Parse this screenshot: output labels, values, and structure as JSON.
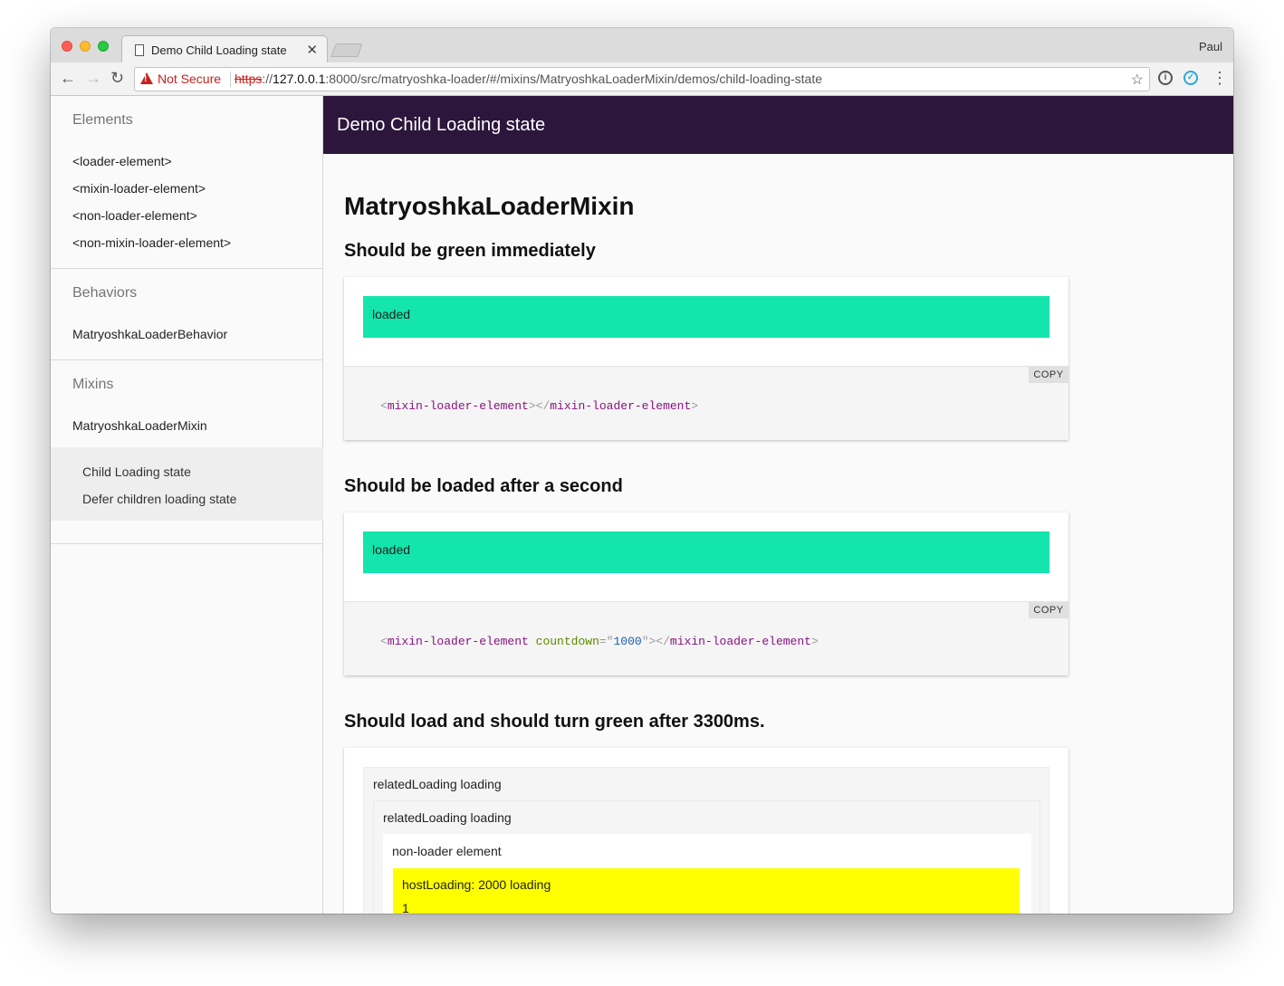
{
  "browser": {
    "tab_title": "Demo Child Loading state",
    "tab_close": "✕",
    "profile": "Paul",
    "security_label": "Not Secure",
    "url_scheme": "https",
    "url_sep": "://",
    "url_host": "127.0.0.1",
    "url_rest": ":8000/src/matryoshka-loader/#/mixins/MatryoshkaLoaderMixin/demos/child-loading-state"
  },
  "sidebar": {
    "sections": [
      {
        "heading": "Elements",
        "items": [
          "<loader-element>",
          "<mixin-loader-element>",
          "<non-loader-element>",
          "<non-mixin-loader-element>"
        ]
      },
      {
        "heading": "Behaviors",
        "items": [
          "MatryoshkaLoaderBehavior"
        ]
      },
      {
        "heading": "Mixins",
        "items": [
          "MatryoshkaLoaderMixin"
        ]
      }
    ],
    "demos": [
      "Child Loading state",
      "Defer children loading state"
    ]
  },
  "main": {
    "app_title": "Demo Child Loading state",
    "page_title": "MatryoshkaLoaderMixin",
    "demos": [
      {
        "heading": "Should be green immediately",
        "status": "loaded",
        "copy_label": "COPY",
        "code": {
          "open": "mixin-loader-element",
          "attr": "",
          "value": "",
          "close": "mixin-loader-element"
        }
      },
      {
        "heading": "Should be loaded after a second",
        "status": "loaded",
        "copy_label": "COPY",
        "code": {
          "open": "mixin-loader-element",
          "attr": "countdown",
          "value": "1000",
          "close": "mixin-loader-element"
        }
      },
      {
        "heading": "Should load and should turn green after 3300ms.",
        "outer_label": "relatedLoading loading",
        "middle_label": "relatedLoading loading",
        "inner_label": "non-loader element",
        "host_label": "hostLoading: 2000 loading",
        "host_count": "1"
      }
    ]
  },
  "colors": {
    "appbar": "#2c163c",
    "loaded": "#14e5ac",
    "loading_host": "#ffff00"
  }
}
